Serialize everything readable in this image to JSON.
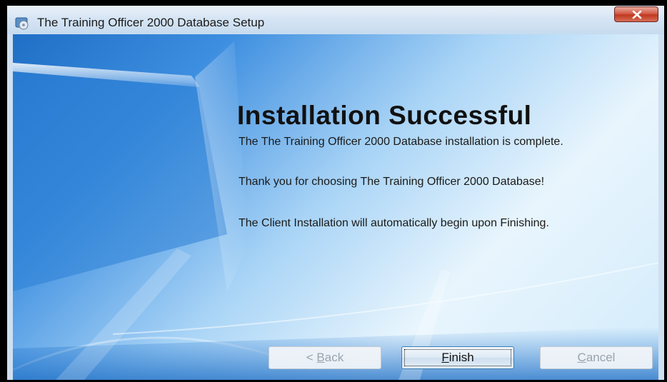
{
  "window": {
    "title": "The Training Officer 2000 Database Setup",
    "close_label": "Close"
  },
  "content": {
    "heading": "Installation Successful",
    "paragraphs": [
      "The The Training Officer 2000 Database  installation is complete.",
      "Thank you for choosing The Training Officer 2000 Database!",
      "The Client Installation will automatically begin upon Finishing."
    ]
  },
  "buttons": {
    "back": {
      "prefix": "< ",
      "mnemonic": "B",
      "rest": "ack",
      "enabled": false
    },
    "finish": {
      "prefix": "",
      "mnemonic": "F",
      "rest": "inish",
      "enabled": true
    },
    "cancel": {
      "prefix": "",
      "mnemonic": "C",
      "rest": "ancel",
      "enabled": false
    }
  },
  "icons": {
    "app": "installer-disc-icon",
    "close": "close-x-icon"
  },
  "colors": {
    "accent_blue": "#2a7fd4",
    "close_red": "#c1371f"
  }
}
